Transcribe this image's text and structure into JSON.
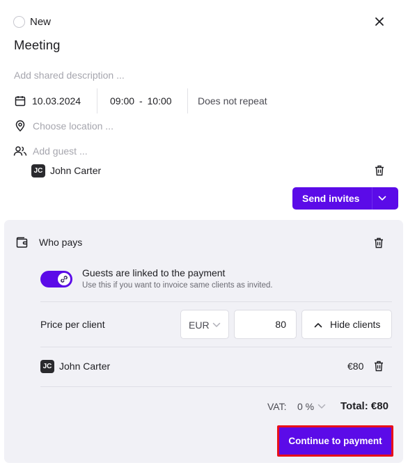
{
  "event": {
    "status_label": "New",
    "title": "Meeting",
    "description_placeholder": "Add shared description ...",
    "date": "10.03.2024",
    "time_start": "09:00",
    "time_separator": "-",
    "time_end": "10:00",
    "repeat": "Does not repeat",
    "location_placeholder": "Choose location ...",
    "guest_placeholder": "Add guest ...",
    "guests": [
      {
        "initials": "JC",
        "name": "John Carter"
      }
    ],
    "send_invites_label": "Send invites"
  },
  "payment": {
    "title": "Who pays",
    "link_title": "Guests are linked to the payment",
    "link_subtitle": "Use this if you want to invoice same clients as invited.",
    "linked": true,
    "price_label": "Price per client",
    "currency": "EUR",
    "price": "80",
    "hide_clients_label": "Hide clients",
    "clients": [
      {
        "initials": "JC",
        "name": "John Carter",
        "amount": "€80"
      }
    ],
    "vat_label": "VAT:",
    "vat_value": "0 %",
    "total": "Total: €80",
    "continue_label": "Continue to payment"
  },
  "colors": {
    "accent": "#5b0be8",
    "panel_bg": "#f1f1f6",
    "highlight_border": "#e8101a"
  },
  "icons": [
    "radio-icon",
    "close-icon",
    "calendar-icon",
    "location-pin-icon",
    "users-icon",
    "trash-icon",
    "chevron-down-icon",
    "wallet-icon",
    "link-icon",
    "chevron-up-icon"
  ]
}
